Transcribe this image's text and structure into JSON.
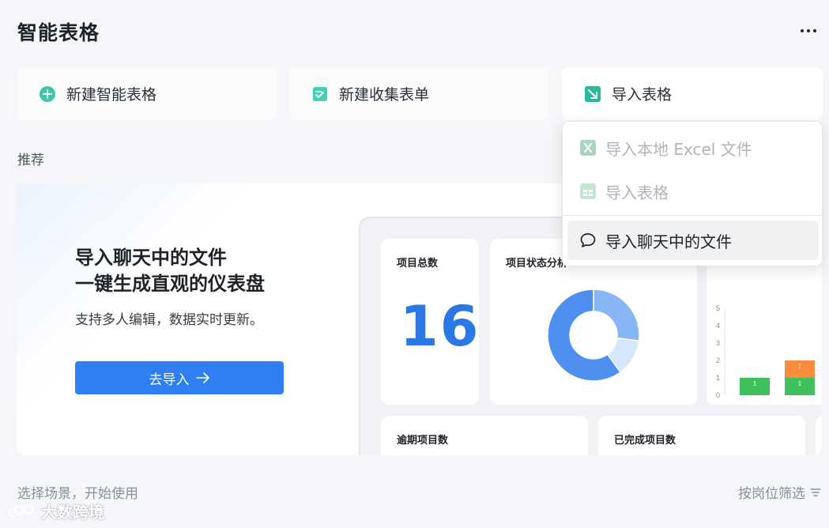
{
  "header": {
    "title": "智能表格"
  },
  "actions": {
    "new_sheet": "新建智能表格",
    "new_form": "新建收集表单",
    "import_sheet": "导入表格"
  },
  "import_menu": {
    "items": [
      {
        "label": "导入本地 Excel 文件",
        "state": "disabled"
      },
      {
        "label": "导入表格",
        "state": "disabled"
      },
      {
        "label": "导入聊天中的文件",
        "state": "hover"
      }
    ]
  },
  "recommend": {
    "label": "推荐",
    "banner": {
      "title_line1": "导入聊天中的文件",
      "title_line2": "一键生成直观的仪表盘",
      "subtitle": "支持多人编辑，数据实时更新。",
      "button_label": "去导入"
    },
    "dashboard": {
      "total_label": "项目总数",
      "total_value": "16",
      "status_label": "项目状态分析",
      "overdue_label": "逾期项目数",
      "done_label": "已完成项目数",
      "bar_labels": [
        "1",
        "1",
        "1"
      ]
    }
  },
  "chart_data": [
    {
      "type": "pie",
      "title": "项目状态分析",
      "slices": [
        {
          "value": 0.6,
          "color": "#4e8ff0"
        },
        {
          "value": 0.27,
          "color": "#86b6f6"
        },
        {
          "value": 0.13,
          "color": "#d6e6fc"
        }
      ]
    },
    {
      "type": "bar",
      "ylim": [
        0,
        5
      ],
      "yticks": [
        "0",
        "1",
        "2",
        "3",
        "4",
        "5"
      ],
      "series": [
        {
          "color": "#3fc05c",
          "values": [
            1,
            1
          ]
        },
        {
          "color": "#fb8c3c",
          "values": [
            0,
            1
          ]
        }
      ]
    }
  ],
  "footer": {
    "scene_label": "选择场景，开始使用",
    "filter_label": "按岗位筛选",
    "watermark": "大数跨境"
  },
  "colors": {
    "primary": "#2f7ff2",
    "accent_green": "#37c99a"
  }
}
